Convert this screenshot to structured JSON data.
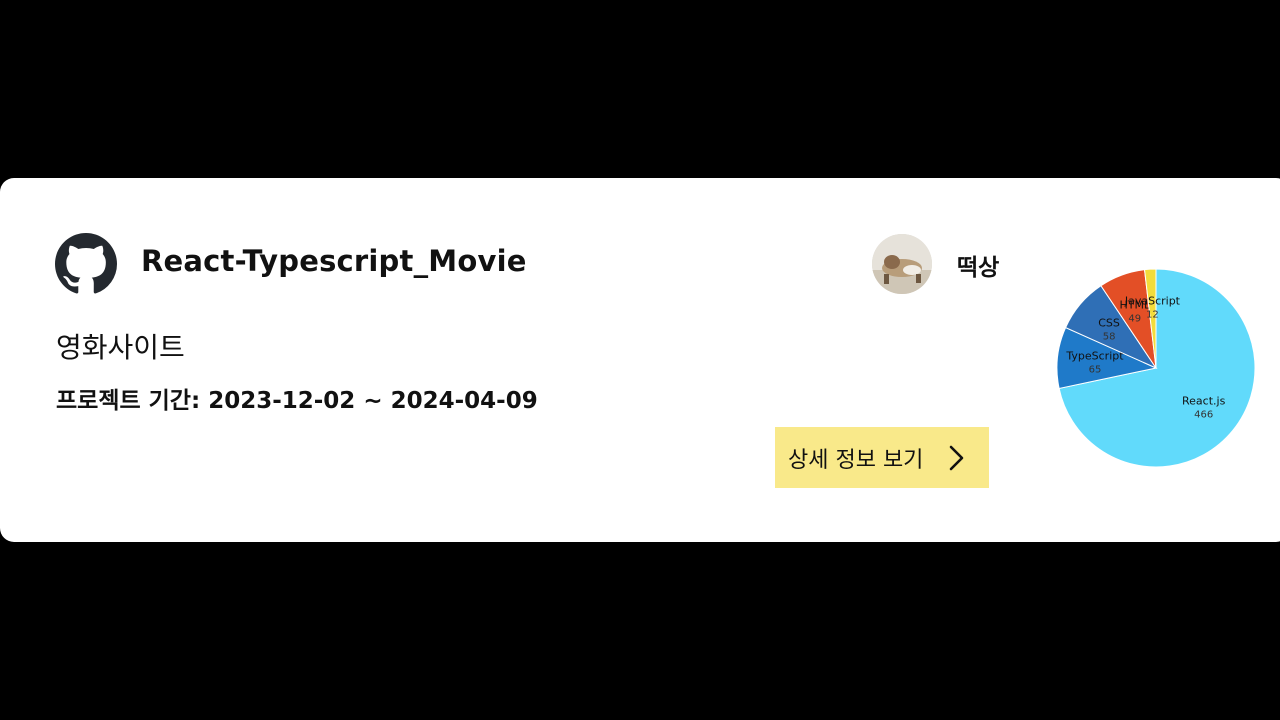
{
  "project": {
    "title": "React-Typescript_Movie",
    "description": "영화사이트",
    "period_label": "프로젝트 기간:",
    "period_value": "2023-12-02 ~ 2024-04-09"
  },
  "owner": {
    "name": "떡상"
  },
  "actions": {
    "detail_label": "상세 정보 보기"
  },
  "icons": {
    "repo": "github-icon",
    "detail": "chevron-right-icon"
  },
  "chart_data": {
    "type": "pie",
    "series": [
      {
        "name": "React.js",
        "value": 466,
        "color": "#61dafb"
      },
      {
        "name": "TypeScript",
        "value": 65,
        "color": "#1f7ac9"
      },
      {
        "name": "CSS",
        "value": 58,
        "color": "#2f6fb6"
      },
      {
        "name": "HTML",
        "value": 49,
        "color": "#e34f26"
      },
      {
        "name": "JavaScript",
        "value": 12,
        "color": "#f3dc3b"
      }
    ]
  }
}
